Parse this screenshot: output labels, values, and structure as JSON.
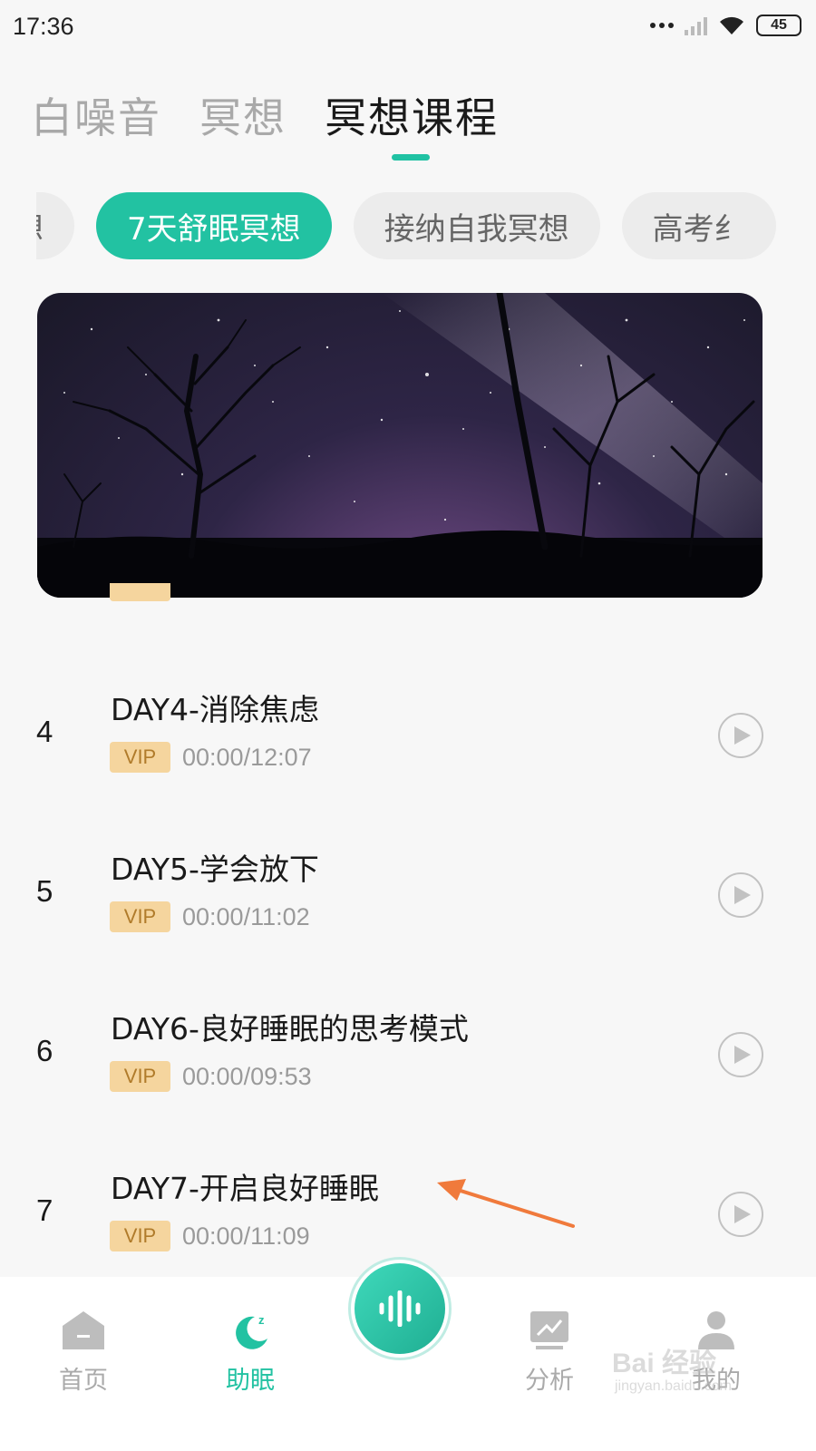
{
  "status_bar": {
    "time": "17:36",
    "battery": "45"
  },
  "top_tabs": [
    {
      "label": "白噪音",
      "active": false
    },
    {
      "label": "冥想",
      "active": false
    },
    {
      "label": "冥想课程",
      "active": true
    }
  ],
  "categories": [
    {
      "label": "想",
      "active": false
    },
    {
      "label": "7天舒眠冥想",
      "active": true
    },
    {
      "label": "接纳自我冥想",
      "active": false
    },
    {
      "label": "高考纟",
      "active": false
    }
  ],
  "lessons": [
    {
      "number": "4",
      "title": "DAY4-消除焦虑",
      "badge": "VIP",
      "time": "00:00/12:07"
    },
    {
      "number": "5",
      "title": "DAY5-学会放下",
      "badge": "VIP",
      "time": "00:00/11:02"
    },
    {
      "number": "6",
      "title": "DAY6-良好睡眠的思考模式",
      "badge": "VIP",
      "time": "00:00/09:53"
    },
    {
      "number": "7",
      "title": "DAY7-开启良好睡眠",
      "badge": "VIP",
      "time": "00:00/11:09"
    }
  ],
  "bottom_nav": {
    "home": "首页",
    "sleep_aid": "助眠",
    "analysis": "分析",
    "mine": "我的"
  },
  "watermark": {
    "text": "Bai 经验",
    "sub": "jingyan.baidu.com"
  },
  "colors": {
    "accent": "#22c2a2",
    "vip_bg": "#f5d59e",
    "vip_text": "#b07b2a",
    "arrow": "#f07a3c"
  }
}
